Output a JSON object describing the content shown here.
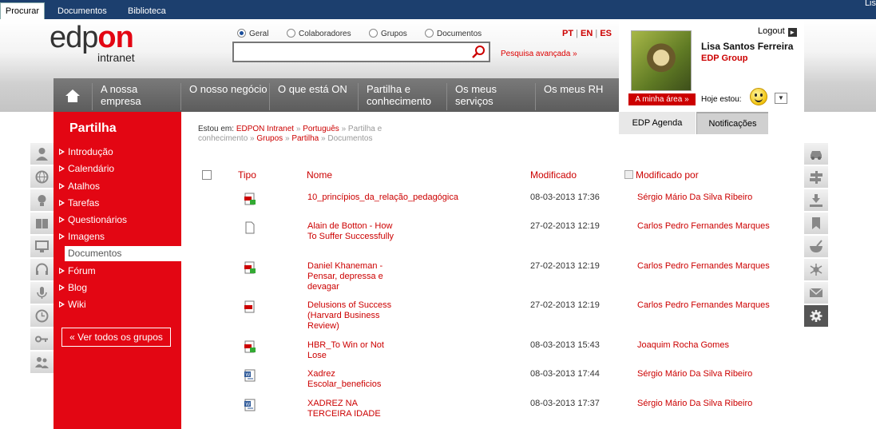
{
  "top_tabs": [
    "Procurar",
    "Documentos",
    "Biblioteca"
  ],
  "top_right_text": "Lis",
  "logo": {
    "edp": "edp",
    "on": "on",
    "sub": "intranet"
  },
  "search": {
    "scopes": [
      "Geral",
      "Colaboradores",
      "Grupos",
      "Documentos"
    ],
    "selected_scope": "Geral",
    "value": "",
    "advanced_label": "Pesquisa avançada »"
  },
  "languages": {
    "pt": "PT",
    "en": "EN",
    "es": "ES",
    "sep": "|"
  },
  "user": {
    "logout_label": "Logout",
    "name": "Lisa Santos Ferreira",
    "group": "EDP Group",
    "my_area_label": "A minha área »",
    "mood_label": "Hoje estou:"
  },
  "nav": {
    "items": [
      {
        "label": "A nossa empresa"
      },
      {
        "label": "O nosso negócio"
      },
      {
        "label": "O que está ON"
      },
      {
        "label": "Partilha e conhecimento"
      },
      {
        "label": "Os meus serviços"
      },
      {
        "label": "Os meus RH"
      }
    ]
  },
  "side_tabs": {
    "agenda": "EDP Agenda",
    "notifications": "Notificações"
  },
  "sidebar": {
    "title": "Partilha",
    "items": [
      "Introdução",
      "Calendário",
      "Atalhos",
      "Tarefas",
      "Questionários",
      "Imagens",
      "Documentos",
      "Fórum",
      "Blog",
      "Wiki"
    ],
    "active": "Documentos",
    "all_groups_label": "« Ver todos os grupos"
  },
  "breadcrumb": {
    "label": "Estou em:",
    "items": [
      "EDPON Intranet",
      "Português",
      "Partilha e conhecimento",
      "Grupos",
      "Partilha",
      "Documentos"
    ],
    "sep": "»"
  },
  "table": {
    "headers": {
      "type": "Tipo",
      "name": "Nome",
      "modified": "Modificado",
      "modified_by": "Modificado por"
    },
    "rows": [
      {
        "icon": "pdf-edit-icon",
        "name": "10_princípios_da_relação_pedagógica",
        "modified": "08-03-2013 17:36",
        "by": "Sérgio Mário Da Silva Ribeiro"
      },
      {
        "icon": "blank-file-icon",
        "name": "Alain de Botton - How To Suffer Successfully",
        "modified": "27-02-2013 12:19",
        "by": "Carlos Pedro Fernandes Marques"
      },
      {
        "icon": "pdf-edit-icon",
        "name": "Daniel Khaneman - Pensar, depressa e devagar",
        "modified": "27-02-2013 12:19",
        "by": "Carlos Pedro Fernandes Marques"
      },
      {
        "icon": "pdf-icon",
        "name": "Delusions of Success (Harvard Business Review)",
        "modified": "27-02-2013 12:19",
        "by": "Carlos Pedro Fernandes Marques"
      },
      {
        "icon": "pdf-edit-icon",
        "name": "HBR_To Win or Not Lose",
        "modified": "08-03-2013 15:43",
        "by": "Joaquim Rocha Gomes"
      },
      {
        "icon": "word-icon",
        "name": "Xadrez Escolar_beneficios",
        "modified": "08-03-2013 17:44",
        "by": "Sérgio Mário Da Silva Ribeiro"
      },
      {
        "icon": "word-icon",
        "name": "XADREZ NA TERCEIRA IDADE",
        "modified": "08-03-2013 17:37",
        "by": "Sérgio Mário Da Silva Ribeiro"
      }
    ]
  },
  "colors": {
    "brand_red": "#e30613",
    "top_bar": "#1c3f6e",
    "nav_grey": "#666666"
  }
}
